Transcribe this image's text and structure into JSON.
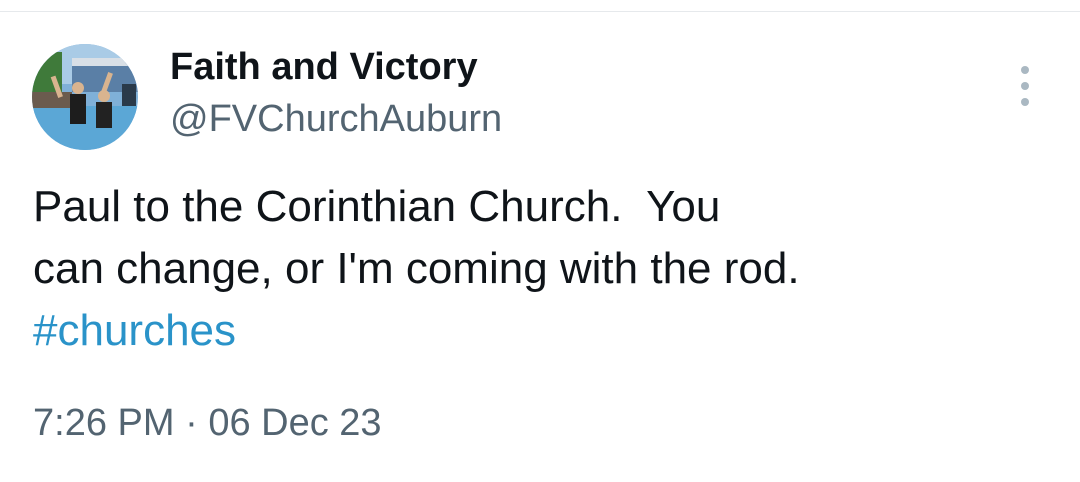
{
  "author": {
    "display_name": "Faith and Victory",
    "handle": "@FVChurchAuburn",
    "avatar": "avatar-photo"
  },
  "tweet": {
    "text_lines": [
      "Paul to the Corinthian Church.  You",
      "can change, or I'm coming with the rod."
    ],
    "hashtag": "#churches",
    "time": "7:26 PM",
    "separator": "·",
    "date": "06 Dec 23"
  },
  "icons": {
    "more": "more-vertical-icon"
  },
  "colors": {
    "text": "#0f1419",
    "secondary": "#536471",
    "hashtag": "#2a93c9",
    "more_dots": "#aab8c2"
  }
}
